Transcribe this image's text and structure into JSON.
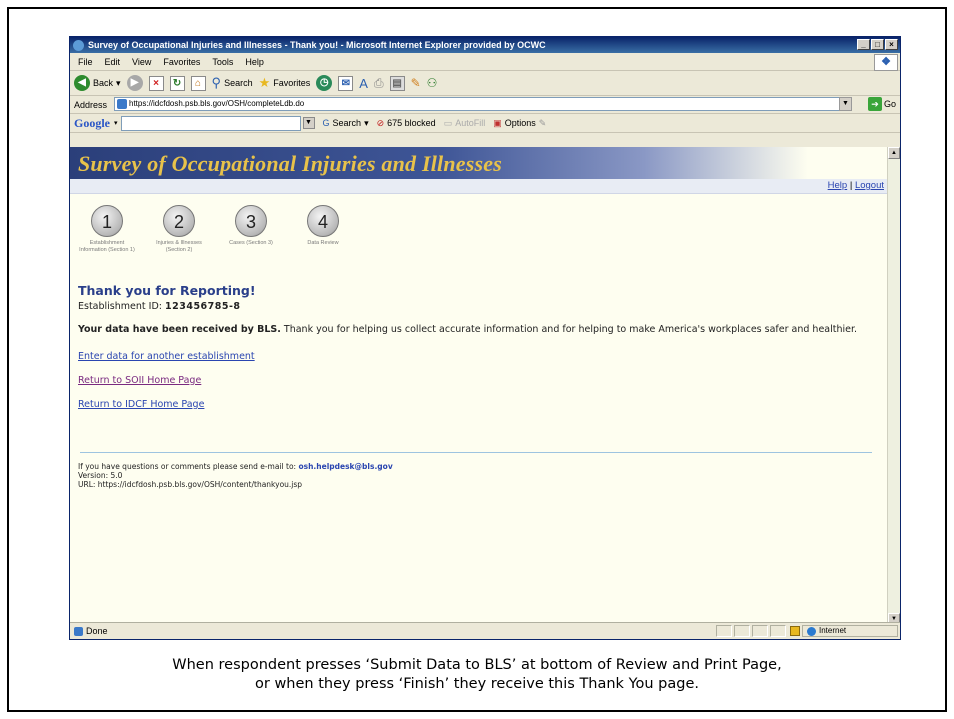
{
  "window": {
    "title": "Survey of Occupational Injuries and Illnesses - Thank you! - Microsoft Internet Explorer provided by OCWC",
    "controls": [
      "_",
      "□",
      "×"
    ]
  },
  "menu": [
    "File",
    "Edit",
    "View",
    "Favorites",
    "Tools",
    "Help"
  ],
  "toolbar": {
    "back_label": "Back",
    "search_label": "Search",
    "favorites_label": "Favorites"
  },
  "address": {
    "label": "Address",
    "url": "https://idcfdosh.psb.bls.gov/OSH/completeLdb.do",
    "go_label": "Go"
  },
  "google_bar": {
    "logo": "Google",
    "search_label": "Search",
    "blocked_label": "675 blocked",
    "autofill_label": "AutoFill",
    "options_label": "Options"
  },
  "page": {
    "banner_title": "Survey of Occupational Injuries and Illnesses",
    "help_link": "Help",
    "separator": "|",
    "logout_link": "Logout",
    "steps": [
      {
        "number": "1",
        "label": "Establishment Information (Section 1)"
      },
      {
        "number": "2",
        "label": "Injuries & Illnesses (Section 2)"
      },
      {
        "number": "3",
        "label": "Cases (Section 3)"
      },
      {
        "number": "4",
        "label": "Data Review"
      }
    ],
    "thanks_heading": "Thank you for Reporting!",
    "establishment_label": "Establishment ID:",
    "establishment_id": "123456785-8",
    "received_bold": "Your data have been received by BLS.",
    "received_text": " Thank you for helping us collect accurate information and for helping to make America's workplaces safer and healthier.",
    "links": [
      "Enter data for another establishment",
      "Return to SOII Home Page",
      "Return to IDCF Home Page"
    ],
    "footer_question": "If you have questions or comments please send e-mail to: ",
    "footer_email": "osh.helpdesk@bls.gov",
    "footer_version": "Version: 5.0",
    "footer_url": "URL: https://idcfdosh.psb.bls.gov/OSH/content/thankyou.jsp"
  },
  "status": {
    "text": "Done",
    "zone": "Internet"
  },
  "caption": {
    "line1": "When respondent presses ‘Submit Data to BLS’ at bottom of Review and Print Page,",
    "line2": "or when they press ‘Finish’ they receive this Thank You page."
  }
}
